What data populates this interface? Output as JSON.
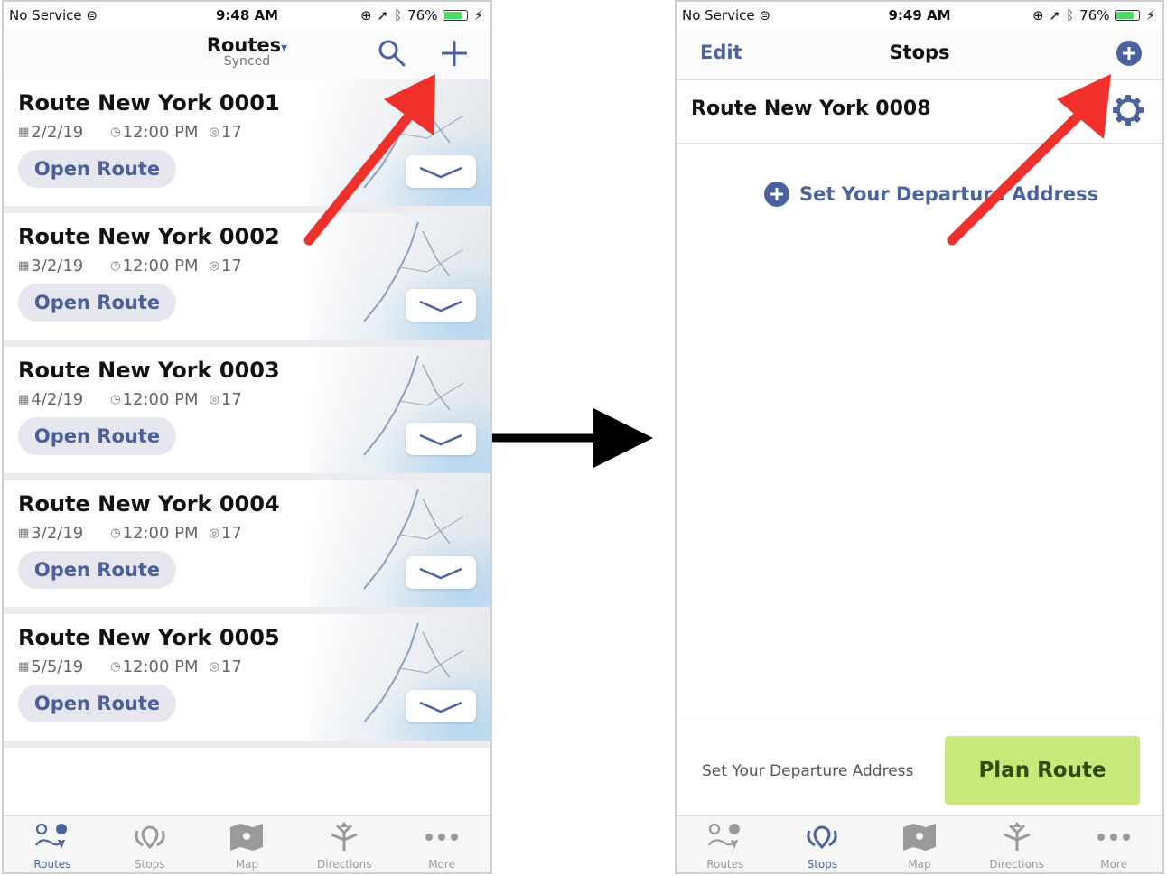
{
  "left": {
    "status": {
      "carrier": "No Service",
      "time": "9:48 AM",
      "battery": "76%"
    },
    "nav": {
      "title": "Routes",
      "title_caret": "▾",
      "subtitle": "Synced"
    },
    "routes": [
      {
        "name": "Route New York 0001",
        "date": "2/2/19",
        "time": "12:00 PM",
        "stops": "17",
        "button": "Open Route"
      },
      {
        "name": "Route New York 0002",
        "date": "3/2/19",
        "time": "12:00 PM",
        "stops": "17",
        "button": "Open Route"
      },
      {
        "name": "Route New York 0003",
        "date": "4/2/19",
        "time": "12:00 PM",
        "stops": "17",
        "button": "Open Route"
      },
      {
        "name": "Route New York 0004",
        "date": "3/2/19",
        "time": "12:00 PM",
        "stops": "17",
        "button": "Open Route"
      },
      {
        "name": "Route New York 0005",
        "date": "5/5/19",
        "time": "12:00 PM",
        "stops": "17",
        "button": "Open Route"
      }
    ],
    "tabs": [
      "Routes",
      "Stops",
      "Map",
      "Directions",
      "More"
    ],
    "active_tab": "Routes"
  },
  "right": {
    "status": {
      "carrier": "No Service",
      "time": "9:49 AM",
      "battery": "76%"
    },
    "nav": {
      "edit": "Edit",
      "title": "Stops"
    },
    "route_name": "Route New York 0008",
    "departure_link": "Set Your Departure Address",
    "footer": {
      "departure_text": "Set Your Departure Address",
      "plan_button": "Plan Route"
    },
    "tabs": [
      "Routes",
      "Stops",
      "Map",
      "Directions",
      "More"
    ],
    "active_tab": "Stops"
  },
  "colors": {
    "accent": "#4a62a0",
    "annotation_arrow": "#f0302a",
    "plan_button_bg": "#c9e87a",
    "plan_button_text": "#2f4c12",
    "open_button_bg": "#e5e6ee"
  }
}
